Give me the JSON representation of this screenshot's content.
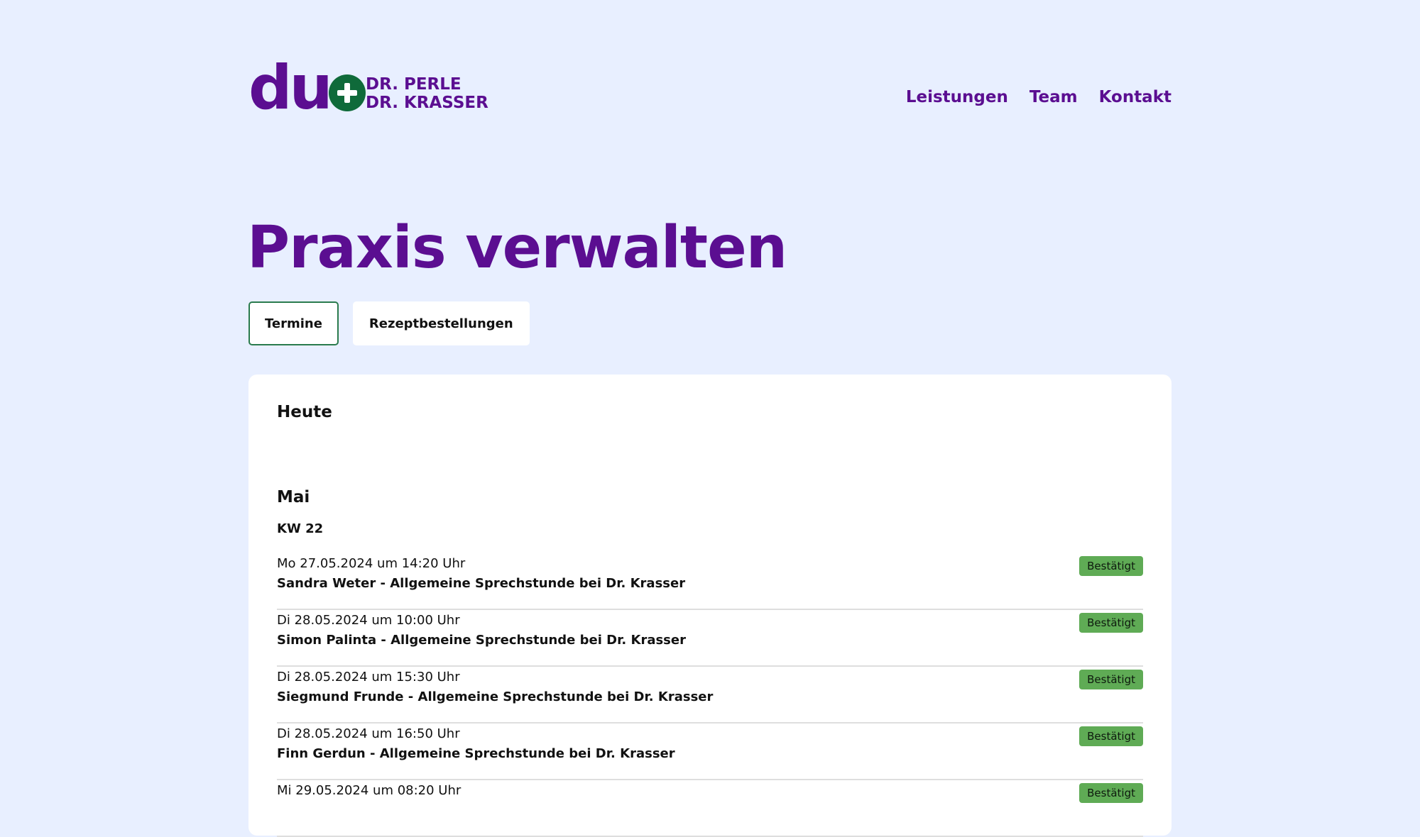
{
  "header": {
    "logo_word": "du",
    "logo_name_1": "DR. PERLE",
    "logo_name_2": "DR. KRASSER",
    "nav": [
      "Leistungen",
      "Team",
      "Kontakt"
    ]
  },
  "page": {
    "title": "Praxis verwalten",
    "tabs": [
      {
        "label": "Termine",
        "active": true
      },
      {
        "label": "Rezeptbestellungen",
        "active": false
      }
    ]
  },
  "appointments": {
    "today_heading": "Heute",
    "month_heading": "Mai",
    "week_heading": "KW 22",
    "items": [
      {
        "when": "Mo 27.05.2024 um 14:20 Uhr",
        "who": "Sandra Weter - Allgemeine Sprechstunde bei Dr. Krasser",
        "status": "Bestätigt"
      },
      {
        "when": "Di 28.05.2024 um 10:00 Uhr",
        "who": "Simon Palinta - Allgemeine Sprechstunde bei Dr. Krasser",
        "status": "Bestätigt"
      },
      {
        "when": "Di 28.05.2024 um 15:30 Uhr",
        "who": "Siegmund Frunde - Allgemeine Sprechstunde bei Dr. Krasser",
        "status": "Bestätigt"
      },
      {
        "when": "Di 28.05.2024 um 16:50 Uhr",
        "who": "Finn Gerdun - Allgemeine Sprechstunde bei Dr. Krasser",
        "status": "Bestätigt"
      },
      {
        "when": "Mi 29.05.2024 um 08:20 Uhr",
        "who": "",
        "status": "Bestätigt"
      }
    ]
  },
  "colors": {
    "background": "#e8efff",
    "brand_purple": "#5b0e91",
    "brand_green": "#0f6a3a",
    "badge_green": "#5fab55"
  }
}
